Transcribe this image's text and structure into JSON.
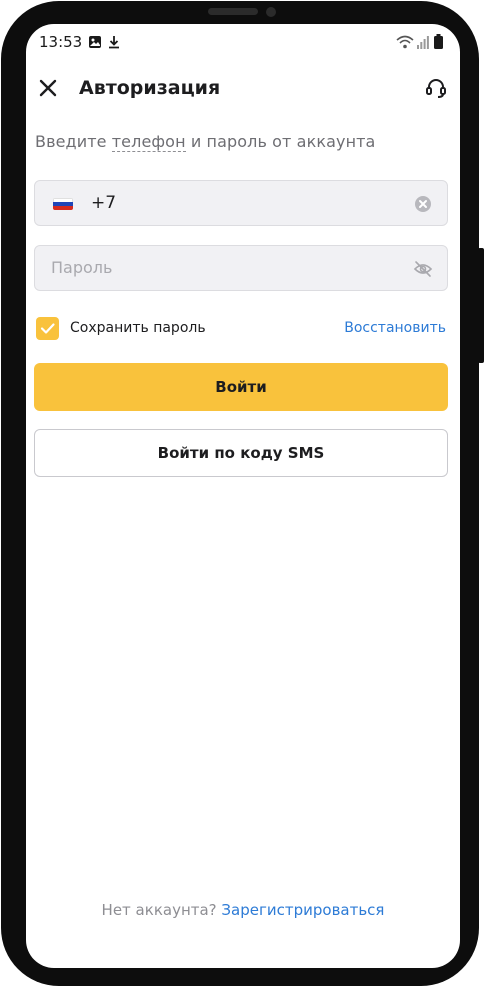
{
  "status_bar": {
    "time": "13:53",
    "icons": [
      "image-icon",
      "download-icon",
      "wifi-icon",
      "signal-icon",
      "battery-icon"
    ]
  },
  "header": {
    "title": "Авторизация",
    "close_icon": "close-icon",
    "support_icon": "headset-icon"
  },
  "form": {
    "subtitle_before": "Введите ",
    "subtitle_link": "телефон",
    "subtitle_after": " и пароль от аккаунта",
    "phone": {
      "country_flag": "russia-flag",
      "value": "+7",
      "clear_icon": "clear-icon"
    },
    "password": {
      "placeholder": "Пароль",
      "value": "",
      "visibility_icon": "eye-off-icon"
    },
    "remember": {
      "label": "Сохранить пароль",
      "checked": true
    },
    "restore_link": "Восстановить",
    "login_button": "Войти",
    "sms_button": "Войти по коду SMS"
  },
  "footer": {
    "question": "Нет аккаунта?",
    "register_link": "Зарегистрироваться"
  },
  "colors": {
    "accent": "#f9c23c",
    "link": "#2d7bd6",
    "field_bg": "#f1f1f4"
  }
}
